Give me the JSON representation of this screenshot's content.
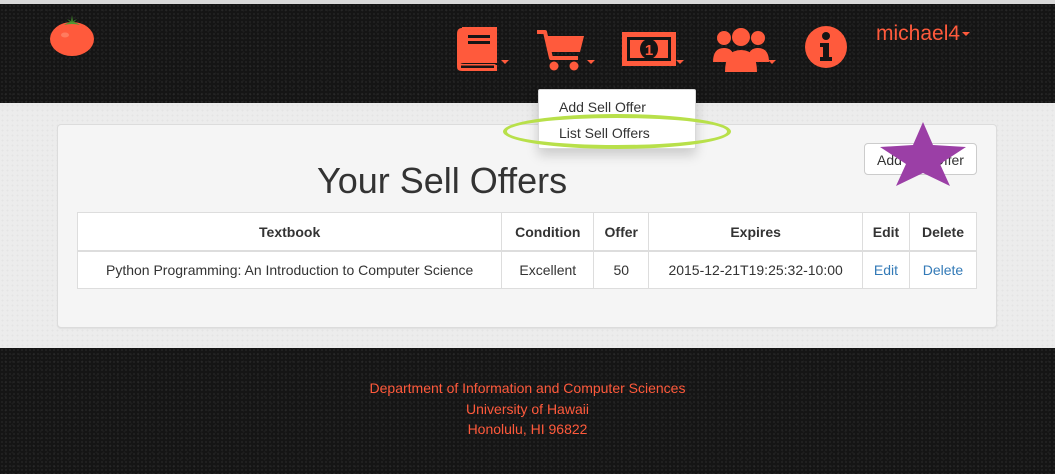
{
  "colors": {
    "accent": "#ff5a3c",
    "highlight": "#b8e04a",
    "star": "#9b3fa6",
    "link": "#337ab7"
  },
  "navbar": {
    "logo": "tomato-icon",
    "icons": [
      "book-icon",
      "cart-icon",
      "money-icon",
      "users-icon",
      "info-icon"
    ],
    "user": "michael4"
  },
  "dropdown": {
    "items": [
      "Add Sell Offer",
      "List Sell Offers"
    ],
    "highlighted": "List Sell Offers"
  },
  "main": {
    "title": "Your Sell Offers",
    "add_button": "Add Sell Offer"
  },
  "table": {
    "headers": [
      "Textbook",
      "Condition",
      "Offer",
      "Expires",
      "Edit",
      "Delete"
    ],
    "rows": [
      {
        "textbook": "Python Programming: An Introduction to Computer Science",
        "condition": "Excellent",
        "offer": "50",
        "expires": "2015-12-21T19:25:32-10:00",
        "edit": "Edit",
        "delete": "Delete"
      }
    ]
  },
  "footer": {
    "lines": [
      "Department of Information and Computer Sciences",
      "University of Hawaii",
      "Honolulu, HI 96822"
    ]
  }
}
